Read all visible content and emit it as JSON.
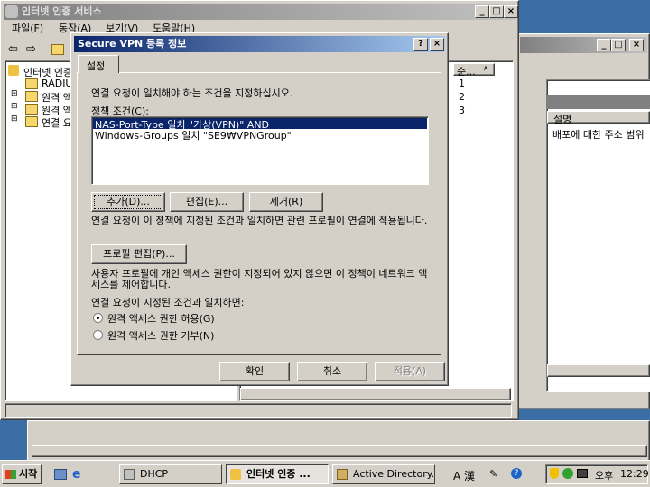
{
  "main_window": {
    "title": "인터넷 인증 서비스",
    "menu": [
      "파일(F)",
      "동작(A)",
      "보기(V)",
      "도움말(H)"
    ],
    "tree": [
      "인터넷 인증",
      "RADIUS",
      "원격 액",
      "원격 액",
      "연결 요"
    ],
    "order_header": "순...",
    "order_values": [
      "1",
      "2",
      "3"
    ]
  },
  "bg_window": {
    "header_desc": "설명",
    "row_desc": "배포에 대한 주소 범위"
  },
  "dialog": {
    "title": "Secure VPN 등록 정보",
    "help_btn": "?",
    "close_btn": "×",
    "tab": "설정",
    "instruction": "연결 요청이 일치해야 하는 조건을 지정하십시오.",
    "conditions_label": "정책 조건(C):",
    "conditions": [
      "NAS-Port-Type 일치 \"가상(VPN)\" AND",
      "Windows-Groups 일치 \"SE9₩VPNGroup\""
    ],
    "add_btn": "추가(D)...",
    "edit_btn": "편집(E)...",
    "remove_btn": "제거(R)",
    "policy_text": "연결 요청이 이 정책에 지정된 조건과 일치하면 관련 프로필이 연결에 적용됩니다.",
    "profile_btn": "프로필 편집(P)...",
    "dialin_text": "사용자 프로필에 개인 액세스 권한이 지정되어 있지 않으면 이 정책이 네트워크 액세스를 제어합니다.",
    "match_label": "연결 요청이 지정된 조건과 일치하면:",
    "grant": "원격 액세스 권한 허용(G)",
    "deny": "원격 액세스 권한 거부(N)",
    "selected": "grant",
    "ok_btn": "확인",
    "cancel_btn": "취소",
    "apply_btn": "적용(A)"
  },
  "taskbar": {
    "start": "시작",
    "tasks": [
      "DHCP",
      "인터넷 인증 ...",
      "Active Directory..."
    ],
    "active_task": 1,
    "ime": "A 漢",
    "ime_mode": "오후",
    "clock": "12:29"
  },
  "colors": {
    "desktop": "#3a6ea5",
    "face": "#d4d0c8",
    "title_active": "#0a246a",
    "selection": "#0a246a"
  }
}
